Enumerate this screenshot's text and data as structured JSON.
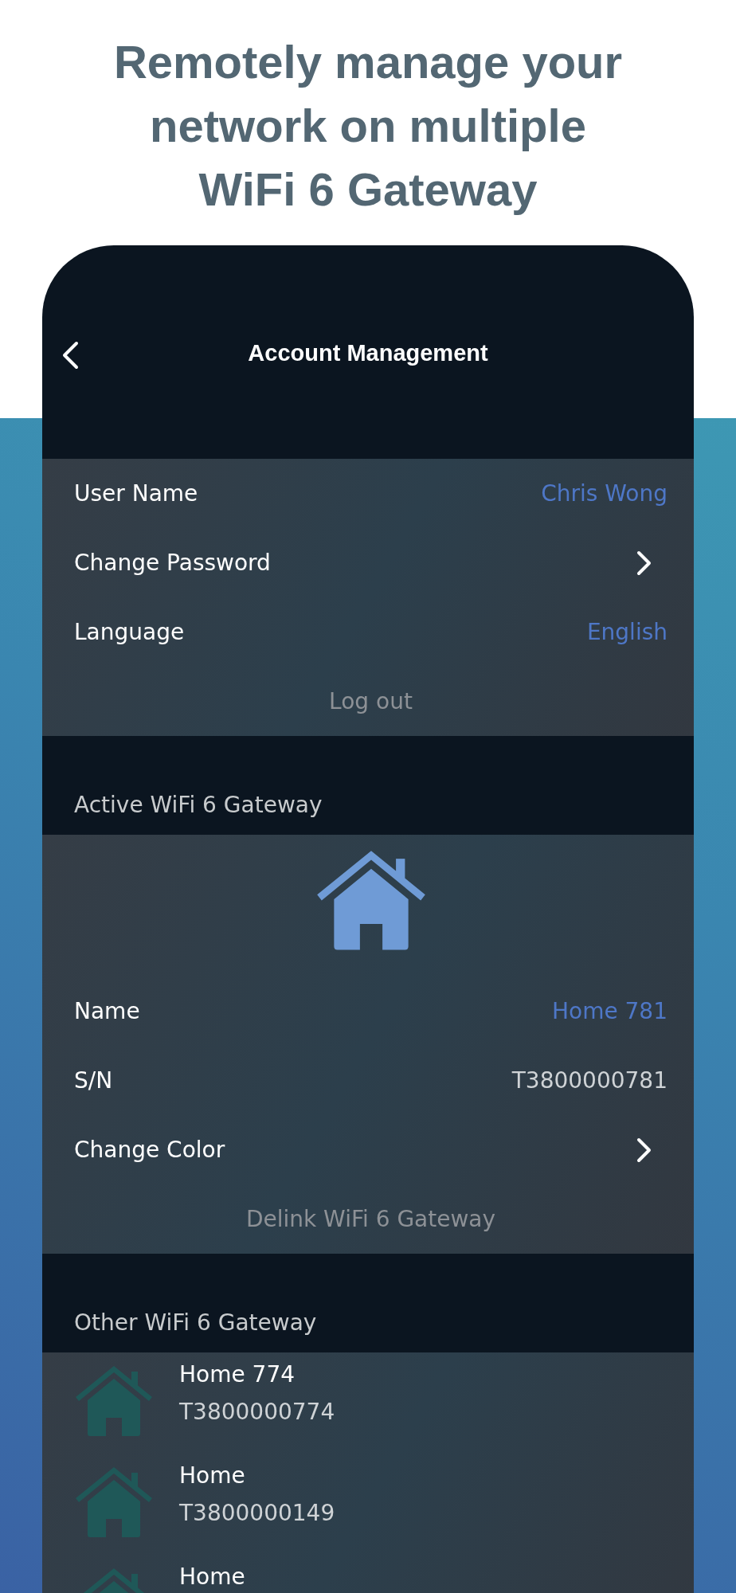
{
  "headline": [
    "Remotely manage your",
    "network on multiple",
    "WiFi 6 Gateway"
  ],
  "nav": {
    "title": "Account Management"
  },
  "account": {
    "rows": [
      {
        "kind": "value",
        "label": "User Name",
        "value": "Chris Wong",
        "accent": true
      },
      {
        "kind": "link",
        "label": "Change Password"
      },
      {
        "kind": "value",
        "label": "Language",
        "value": "English",
        "accent": true
      }
    ],
    "action": "Log out"
  },
  "active_gateway": {
    "header": "Active WiFi 6 Gateway",
    "color": "#6f9bd6",
    "rows": [
      {
        "kind": "value",
        "label": "Name",
        "value": "Home 781",
        "accent": true
      },
      {
        "kind": "value",
        "label": "S/N",
        "value": "T3800000781",
        "accent": false
      },
      {
        "kind": "link",
        "label": "Change Color"
      }
    ],
    "action": "Delink WiFi 6 Gateway"
  },
  "other_gateways": {
    "header": "Other WiFi 6 Gateway",
    "items": [
      {
        "name": "Home 774",
        "serial": "T3800000774",
        "color": "#1f5858"
      },
      {
        "name": "Home",
        "serial": "T3800000149",
        "color": "#1f5858"
      },
      {
        "name": "Home",
        "color": "#1f5858"
      }
    ]
  }
}
